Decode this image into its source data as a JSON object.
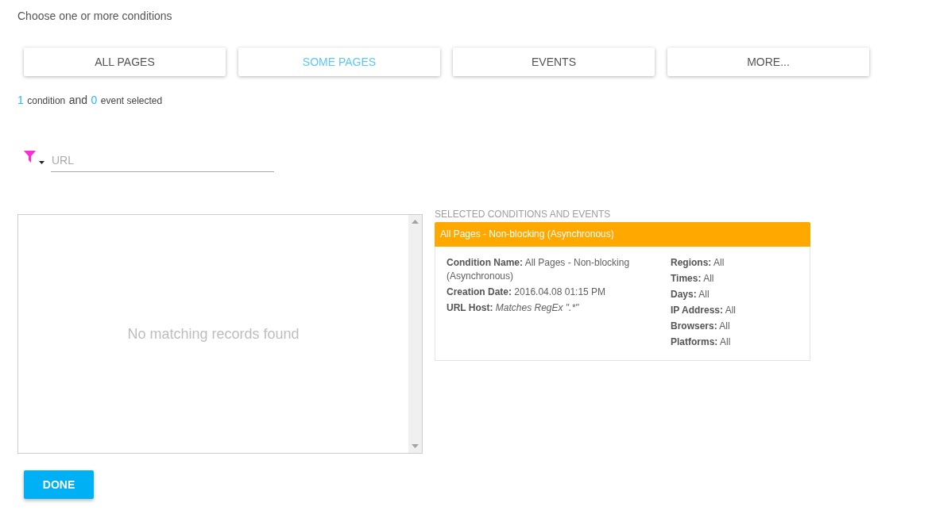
{
  "heading": "Choose one or more conditions",
  "condition_types": [
    {
      "label": "ALL PAGES",
      "selected": false
    },
    {
      "label": "SOME PAGES",
      "selected": true
    },
    {
      "label": "EVENTS",
      "selected": false
    },
    {
      "label": "MORE...",
      "selected": false
    }
  ],
  "summary": {
    "condition_count": "1",
    "condition_label": "condition",
    "joiner": "and",
    "event_count": "0",
    "event_label": "event selected"
  },
  "filter": {
    "placeholder": "URL"
  },
  "records": {
    "empty_message": "No matching records found"
  },
  "selected_panel": {
    "title": "SELECTED CONDITIONS AND EVENTS",
    "items": [
      {
        "title": "All Pages - Non-blocking (Asynchronous)",
        "details": [
          {
            "label": "Condition Name:",
            "value": "All Pages - Non-blocking (Asynchronous)",
            "italic": false
          },
          {
            "label": "Creation Date:",
            "value": "2016.04.08 01:15 PM",
            "italic": false
          },
          {
            "label": "URL Host:",
            "value": "Matches RegEx \".*\"",
            "italic": true
          }
        ],
        "filters": [
          {
            "label": "Regions:",
            "value": "All"
          },
          {
            "label": "Times:",
            "value": "All"
          },
          {
            "label": "Days:",
            "value": "All"
          },
          {
            "label": "IP Address:",
            "value": "All"
          },
          {
            "label": "Browsers:",
            "value": "All"
          },
          {
            "label": "Platforms:",
            "value": "All"
          }
        ]
      }
    ]
  },
  "done_button": "DONE"
}
